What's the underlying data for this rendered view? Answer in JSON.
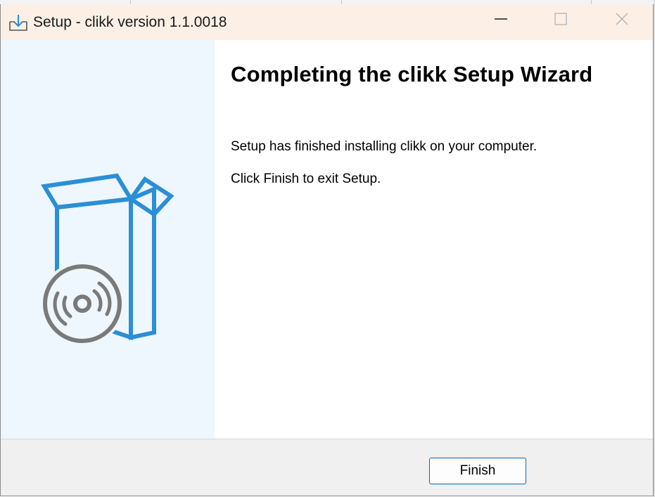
{
  "window": {
    "title": "Setup - clikk version 1.1.0018"
  },
  "titlebar": {
    "icons": [
      "download-icon",
      "minimize-icon",
      "maximize-icon",
      "close-icon"
    ]
  },
  "sidebar": {
    "image": "software-box-with-disc-icon",
    "colors": {
      "background": "#eef7fd",
      "box_outline": "#2a8fd6",
      "disc": "#7a7a7a"
    }
  },
  "content": {
    "heading": "Completing the clikk Setup Wizard",
    "line1": "Setup has finished installing clikk on your computer.",
    "line2": "Click Finish to exit Setup."
  },
  "footer": {
    "finish_label": "Finish",
    "accent": "#0067c0"
  }
}
